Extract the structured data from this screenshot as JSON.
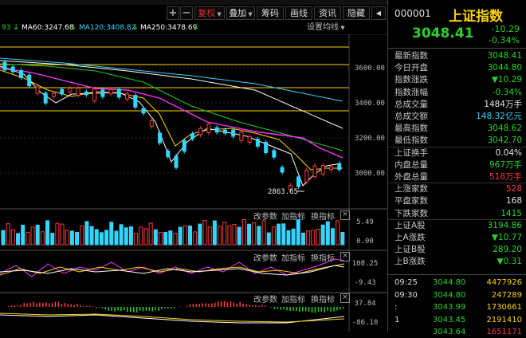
{
  "toolbar": {
    "plus": "+",
    "minus": "−",
    "fuquan": "复权",
    "diejia": "叠加",
    "chouma": "筹码",
    "huaxian": "画线",
    "dugou": "资讯",
    "yincang": "隐藏",
    "back": "◀",
    "forward": "▶"
  },
  "ma_legend": {
    "ma_prefix": "93",
    "ma60": "MA60:3247.68",
    "ma120": "MA120:3408.82",
    "ma250": "MA250:3478.69",
    "settings": "设置均线"
  },
  "colors": {
    "ma60": "#ffffff",
    "ma120": "#33d6ff",
    "ma250": "#ffffff",
    "up": "#ff3b3b",
    "down": "#2bd12b",
    "ma5": "#ffffff",
    "ma10": "#ffd200",
    "ma20": "#ff30ff",
    "ma30": "#22cc22"
  },
  "price_axis": [
    "3600.00",
    "3400.00",
    "3200.00",
    "3000.00"
  ],
  "low_label": "2863.65",
  "panels": {
    "volume": {
      "tools": [
        "改参数",
        "加指标",
        "换指标"
      ],
      "close": "×",
      "axis_top": "5.49",
      "axis_bottom": "0.00"
    },
    "macd1": {
      "tools": [
        "改参数",
        "加指标",
        "换指标"
      ],
      "close": "×",
      "axis_top": "108.25",
      "axis_bottom": "-9.43"
    },
    "macd2": {
      "tools": [
        "改参数",
        "加指标",
        "换指标"
      ],
      "close": "×",
      "axis_top": "37.84",
      "axis_bottom": "-86.10"
    }
  },
  "quote": {
    "code": "000001",
    "name": "上证指数",
    "price": "3048.41",
    "change": "-10.29",
    "change_pct": "-0.34%"
  },
  "stats": [
    {
      "label": "最新指数",
      "value": "3048.41",
      "color": "dn"
    },
    {
      "label": "今日开盘",
      "value": "3044.80",
      "color": "dn"
    },
    {
      "label": "指数涨跌",
      "value": "▼10.29",
      "color": "dn"
    },
    {
      "label": "指数涨幅",
      "value": "-0.34%",
      "color": "dn"
    },
    {
      "label": "总成交量",
      "value": "1484万手",
      "color": "wh"
    },
    {
      "label": "总成交额",
      "value": "148.32亿元",
      "color": "cy"
    },
    {
      "label": "最高指数",
      "value": "3048.62",
      "color": "dn"
    },
    {
      "label": "最低指数",
      "value": "3042.70",
      "color": "dn"
    },
    {
      "label": "上证换手",
      "value": "0.04%",
      "color": "wh"
    },
    {
      "label": "内盘总量",
      "value": "967万手",
      "color": "dn"
    },
    {
      "label": "外盘总量",
      "value": "518万手",
      "color": "up"
    },
    {
      "label": "上涨家数",
      "value": "528",
      "color": "up"
    },
    {
      "label": "平盘家数",
      "value": "168",
      "color": "wh"
    },
    {
      "label": "下跌家数",
      "value": "1415",
      "color": "dn"
    },
    {
      "label": "上证A股",
      "value": "3194.86",
      "color": "dn"
    },
    {
      "label": "上A涨跌",
      "value": "▼10.77",
      "color": "dn"
    },
    {
      "label": "上证B股",
      "value": "289.20",
      "color": "dn"
    },
    {
      "label": "上B涨跌",
      "value": "▼0.31",
      "color": "dn"
    }
  ],
  "ticks": [
    {
      "time": "09:25",
      "price": "3044.80",
      "vol": "4477926"
    },
    {
      "time": "09:30",
      "price": "3044.80",
      "vol": "247289"
    },
    {
      "time": ":",
      "price": "3043.99",
      "vol": "1730661"
    },
    {
      "time": "1",
      "price": "3043.45",
      "vol": "2191410"
    },
    {
      "time": "",
      "price": "3043.64",
      "vol": "1651171"
    }
  ]
}
